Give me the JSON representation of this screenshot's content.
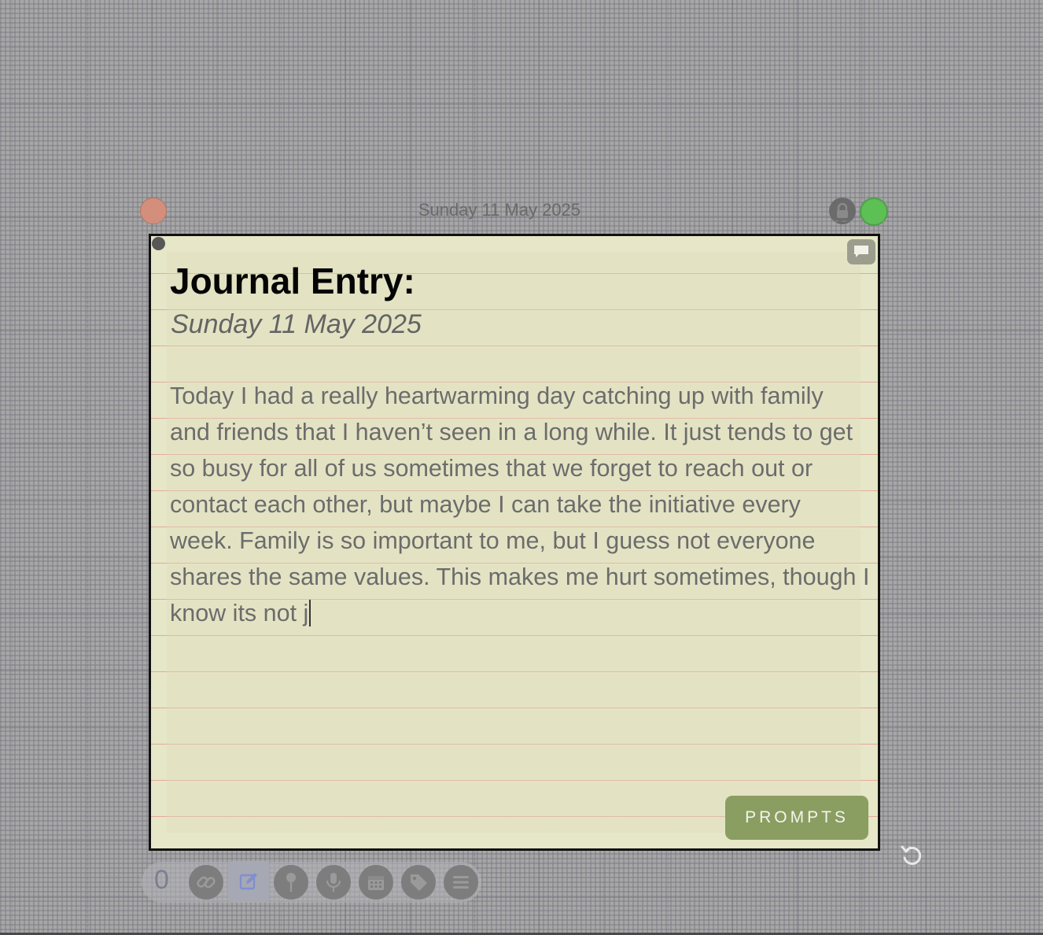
{
  "header": {
    "date": "Sunday 11 May 2025"
  },
  "note": {
    "title": "Journal Entry:",
    "date": "Sunday 11 May 2025",
    "body": "Today I had a really heartwarming day catching up with family and friends that I haven’t seen in a long while. It just tends to get so busy for all of us sometimes that we forget to reach out or contact each other, but maybe I can take the initiative every week. Family is so important to me, but I guess not everyone shares the same values. This makes me hurt sometimes, though I know its not j",
    "prompts_label": "PROMPTS"
  },
  "toolbar": {
    "count": "0",
    "tools": [
      "link-icon",
      "edit-icon",
      "pin-icon",
      "microphone-icon",
      "calendar-icon",
      "tag-icon",
      "menu-icon"
    ]
  },
  "colors": {
    "background": "#a7a7a7",
    "note_paper": "#e6e6c8",
    "rule_line": "#e2968c",
    "close_dot": "#d48f7c",
    "green_dot": "#5cc055",
    "prompts_button": "#8a9e62"
  }
}
